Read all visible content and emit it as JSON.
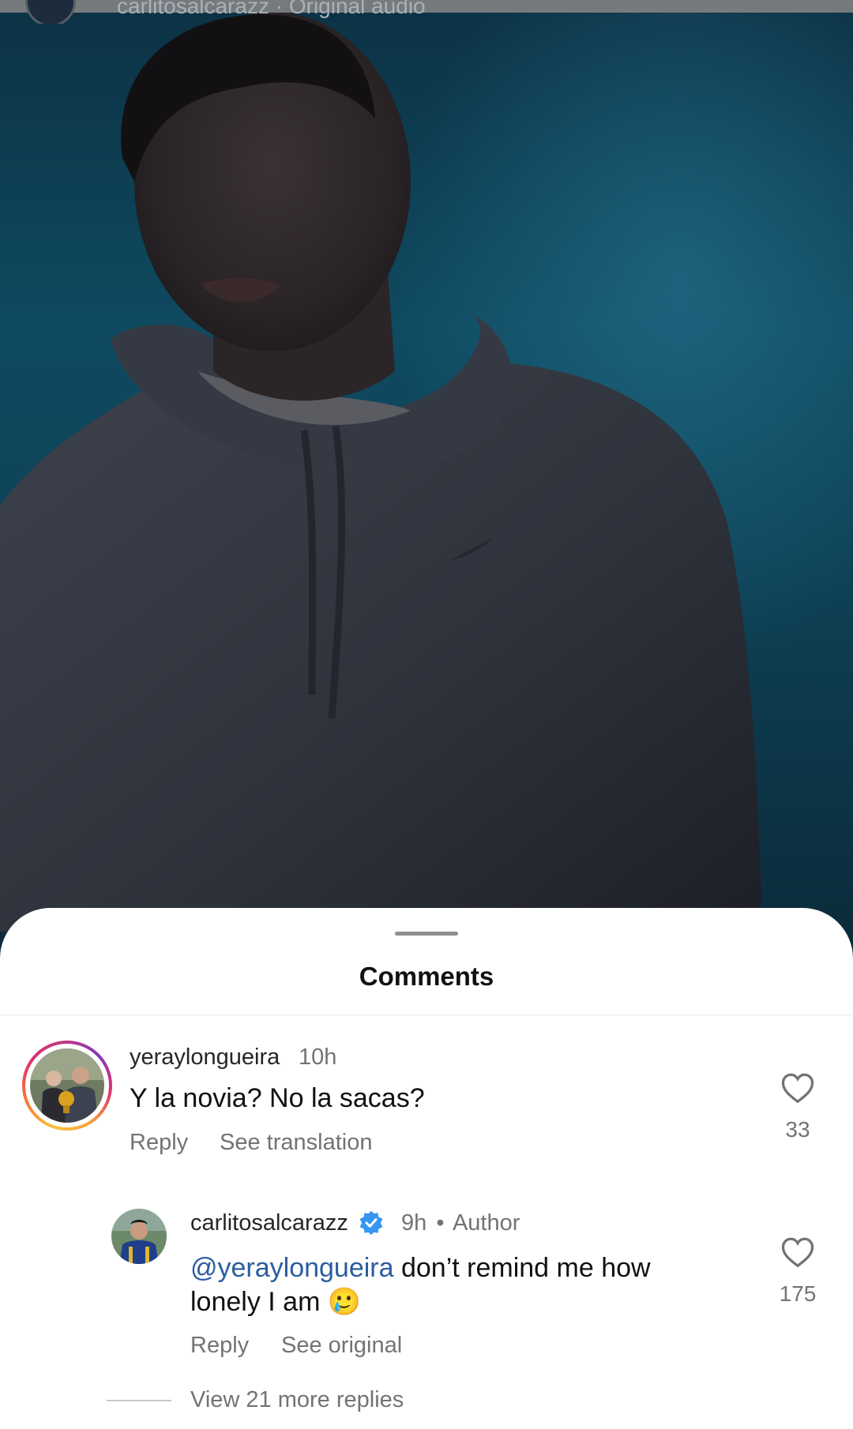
{
  "video": {
    "top_username": "carlitosalcarazz",
    "top_audio": "Original audio"
  },
  "sheet": {
    "title": "Comments"
  },
  "comments": [
    {
      "username": "yeraylongueira",
      "time": "10h",
      "text": "Y la novia? No la sacas?",
      "actions": [
        "Reply",
        "See translation"
      ],
      "likes": "33"
    }
  ],
  "reply": {
    "username": "carlitosalcarazz",
    "time": "9h",
    "separator": "•",
    "author_label": "Author",
    "mention": "@yeraylongueira",
    "text": " don’t remind me how lonely I am 🥲",
    "actions": [
      "Reply",
      "See original"
    ],
    "likes": "175"
  },
  "view_more": "View 21 more replies",
  "colors": {
    "mention": "#2a5d9e",
    "verified": "#3797f0",
    "secondary_text": "#737373"
  },
  "icons": [
    "heart-icon",
    "verified-badge-icon",
    "drag-handle-icon"
  ]
}
